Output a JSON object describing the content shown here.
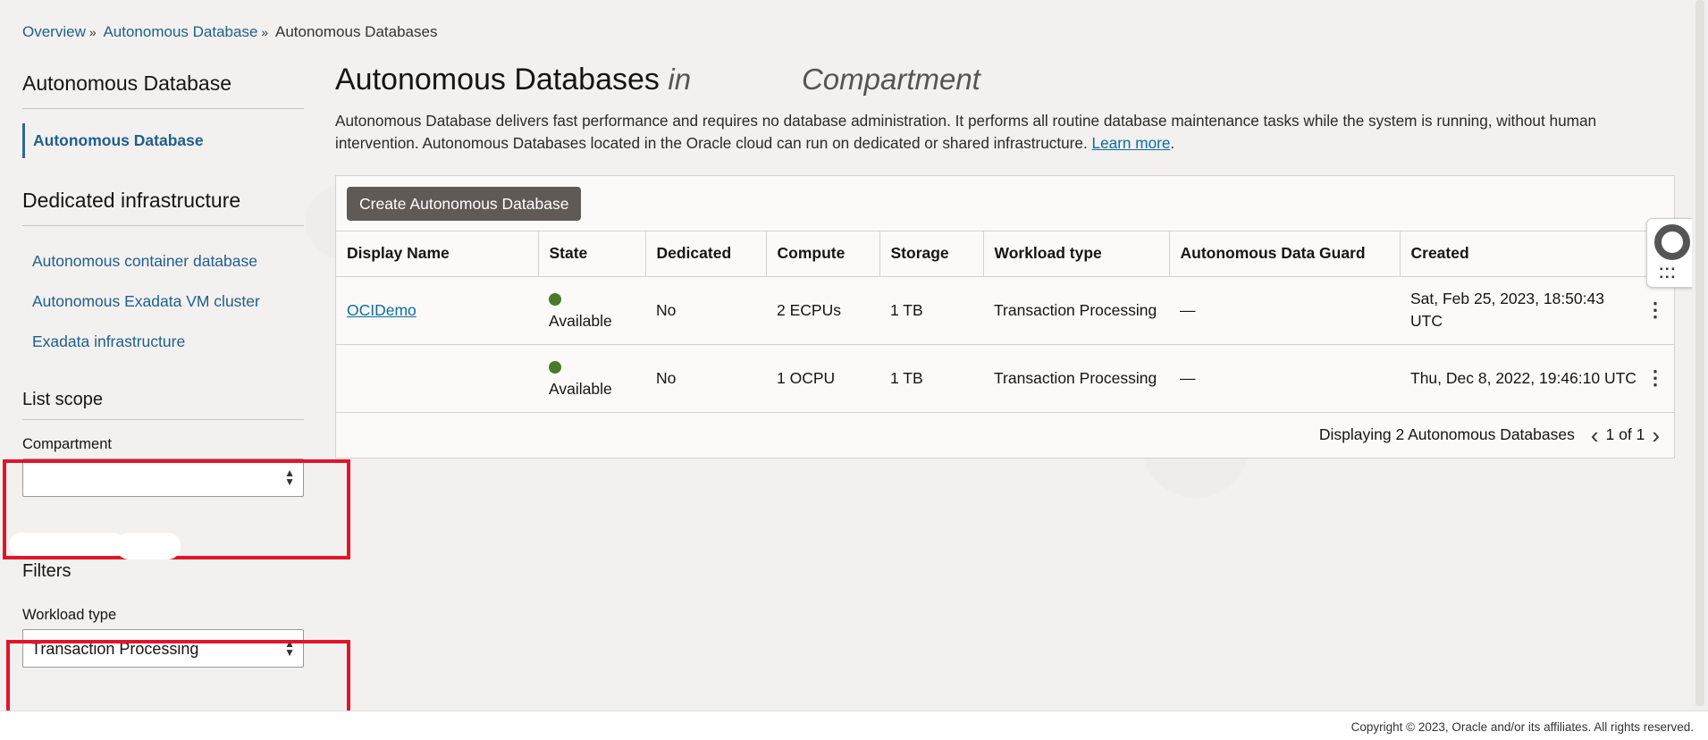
{
  "breadcrumb": {
    "items": [
      {
        "label": "Overview"
      },
      {
        "label": "Autonomous Database"
      },
      {
        "label": "Autonomous Databases"
      }
    ],
    "separator": "»"
  },
  "sidebar": {
    "heading1": "Autonomous Database",
    "active_item": "Autonomous Database",
    "heading2": "Dedicated infrastructure",
    "items": [
      {
        "label": "Autonomous container database"
      },
      {
        "label": "Autonomous Exadata VM cluster"
      },
      {
        "label": "Exadata infrastructure"
      }
    ],
    "list_scope": "List scope",
    "compartment_label": "Compartment",
    "compartment_value": "",
    "filters": "Filters",
    "workload_label": "Workload type",
    "workload_value": "Transaction Processing"
  },
  "main": {
    "title": "Autonomous Databases",
    "title_in": "in",
    "title_compartment": "Compartment",
    "description": "Autonomous Database delivers fast performance and requires no database administration. It performs all routine database maintenance tasks while the system is running, without human intervention. Autonomous Databases located in the Oracle cloud can run on dedicated or shared infrastructure.",
    "learn_more": "Learn more",
    "create_button": "Create Autonomous Database"
  },
  "table": {
    "headers": [
      "Display Name",
      "State",
      "Dedicated",
      "Compute",
      "Storage",
      "Workload type",
      "Autonomous Data Guard",
      "Created"
    ],
    "rows": [
      {
        "name": "OCIDemo",
        "state": "Available",
        "dedicated": "No",
        "compute": "2 ECPUs",
        "storage": "1 TB",
        "workload": "Transaction Processing",
        "data_guard": "—",
        "created": "Sat, Feb 25, 2023, 18:50:43 UTC"
      },
      {
        "name": "",
        "state": "Available",
        "dedicated": "No",
        "compute": "1 OCPU",
        "storage": "1 TB",
        "workload": "Transaction Processing",
        "data_guard": "—",
        "created": "Thu, Dec 8, 2022, 19:46:10 UTC"
      }
    ],
    "footer_text": "Displaying 2 Autonomous Databases",
    "page_info": "1 of 1"
  },
  "footer": {
    "copyright": "Copyright © 2023, Oracle and/or its affiliates. All rights reserved."
  },
  "colors": {
    "status_available": "#4b7a2a",
    "highlight_box": "#e3142a",
    "button_bg": "#5f5a56",
    "link": "#0e6ca0"
  }
}
